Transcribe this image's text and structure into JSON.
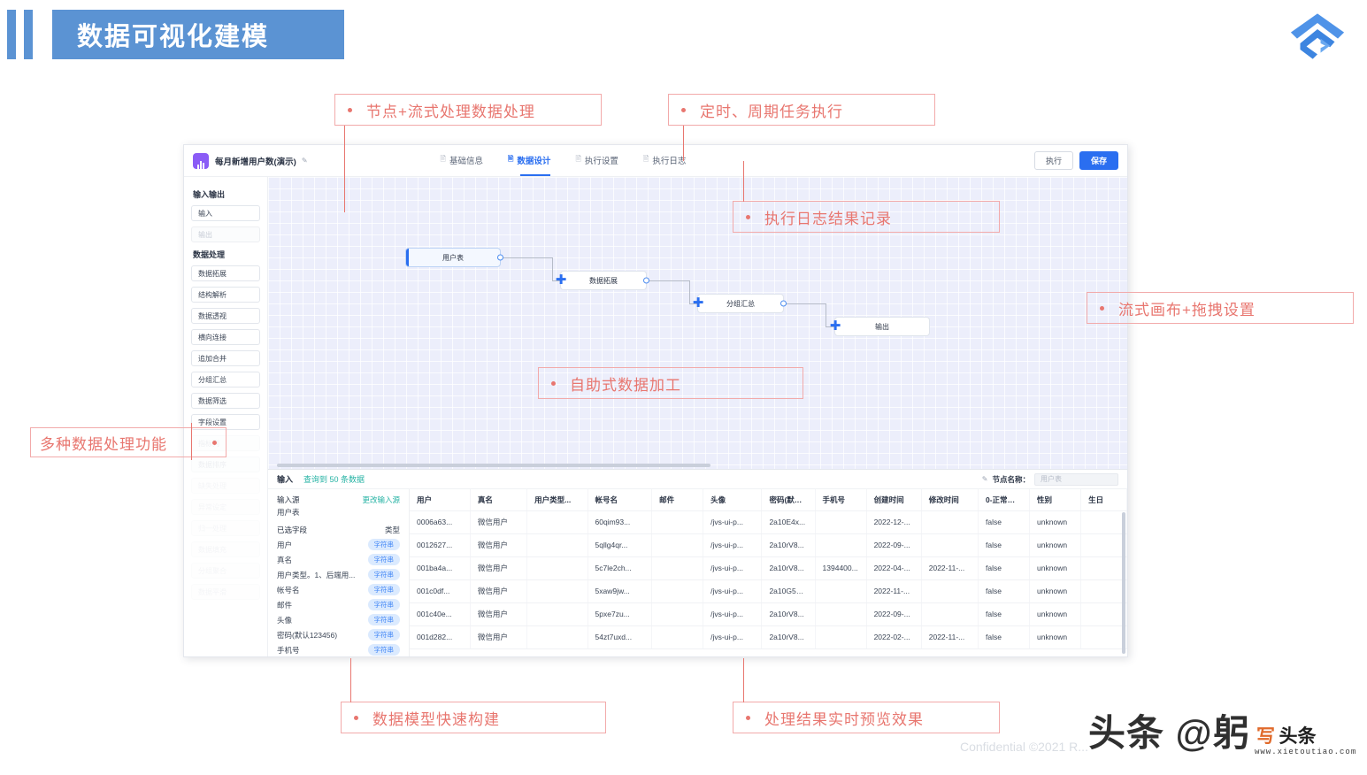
{
  "slide": {
    "title": "数据可视化建模",
    "footer": "Confidential ©2021 R...",
    "watermark": "头条 @躬",
    "watermark_badge_1": "写",
    "watermark_badge_2": "头条",
    "watermark_url": "www.xietoutiao.com",
    "logo": "company-logo-icon",
    "accent_color": "#5b93d3",
    "callout_color": "#e8766f"
  },
  "callouts": [
    {
      "id": "c1",
      "text": "节点+流式处理数据处理"
    },
    {
      "id": "c2",
      "text": "定时、周期任务执行"
    },
    {
      "id": "c3",
      "text": "执行日志结果记录"
    },
    {
      "id": "c4",
      "text": "流式画布+拖拽设置"
    },
    {
      "id": "c5",
      "text": "自助式数据加工"
    },
    {
      "id": "c6",
      "text": "多种数据处理功能"
    },
    {
      "id": "c7",
      "text": "数据模型快速构建"
    },
    {
      "id": "c8",
      "text": "处理结果实时预览效果"
    }
  ],
  "app": {
    "doc_title": "每月新增用户数(演示)",
    "edit_icon": "pencil-icon",
    "tabs": [
      {
        "label": "基础信息",
        "icon": "doc-icon",
        "active": false
      },
      {
        "label": "数据设计",
        "icon": "doc-icon",
        "active": true
      },
      {
        "label": "执行设置",
        "icon": "doc-icon",
        "active": false
      },
      {
        "label": "执行日志",
        "icon": "doc-icon",
        "active": false
      }
    ],
    "actions": {
      "run": "执行",
      "save": "保存"
    },
    "sidebar": {
      "group_io": "输入输出",
      "group_process": "数据处理",
      "io_items": [
        {
          "label": "输入",
          "state": "enabled"
        },
        {
          "label": "输出",
          "state": "disabled"
        }
      ],
      "process_items": [
        {
          "label": "数据拓展",
          "state": "enabled",
          "fade": "none"
        },
        {
          "label": "结构解析",
          "state": "enabled",
          "fade": "none"
        },
        {
          "label": "数据透视",
          "state": "enabled",
          "fade": "none"
        },
        {
          "label": "横向连接",
          "state": "enabled",
          "fade": "none"
        },
        {
          "label": "追加合并",
          "state": "enabled",
          "fade": "none"
        },
        {
          "label": "分组汇总",
          "state": "enabled",
          "fade": "none"
        },
        {
          "label": "数据筛选",
          "state": "enabled",
          "fade": "none"
        },
        {
          "label": "字段设置",
          "state": "enabled",
          "fade": "none"
        },
        {
          "label": "指标列",
          "state": "disabled",
          "fade": "faded"
        },
        {
          "label": "数据排序",
          "state": "disabled",
          "fade": "faded"
        },
        {
          "label": "缺失处理",
          "state": "disabled",
          "fade": "faded2"
        },
        {
          "label": "异常设定",
          "state": "disabled",
          "fade": "faded2"
        },
        {
          "label": "归一处理",
          "state": "disabled",
          "fade": "faded2"
        },
        {
          "label": "数据填充",
          "state": "disabled",
          "fade": "faded2"
        },
        {
          "label": "分组聚合",
          "state": "disabled",
          "fade": "faded2"
        },
        {
          "label": "数据平滑",
          "state": "disabled",
          "fade": "faded2"
        }
      ]
    },
    "canvas": {
      "nodes": [
        {
          "id": "n1",
          "label": "用户表",
          "kind": "source"
        },
        {
          "id": "n2",
          "label": "数据拓展",
          "kind": "process"
        },
        {
          "id": "n3",
          "label": "分组汇总",
          "kind": "process"
        },
        {
          "id": "n4",
          "label": "输出",
          "kind": "sink"
        }
      ]
    },
    "data_panel": {
      "input_label": "输入",
      "count_text": "查询到 50 条数据",
      "node_name_label": "节点名称：",
      "node_name_value": "用户表",
      "source_label": "输入源",
      "change_source": "更改输入源",
      "source_value": "用户表",
      "selected_fields_label": "已选字段",
      "type_label": "类型",
      "fields": [
        {
          "name": "用户",
          "type": "字符串"
        },
        {
          "name": "真名",
          "type": "字符串"
        },
        {
          "name": "用户类型。1、后端用...",
          "type": "字符串"
        },
        {
          "name": "帐号名",
          "type": "字符串"
        },
        {
          "name": "邮件",
          "type": "字符串"
        },
        {
          "name": "头像",
          "type": "字符串"
        },
        {
          "name": "密码(默认123456)",
          "type": "字符串"
        },
        {
          "name": "手机号",
          "type": "字符串"
        }
      ],
      "table": {
        "columns": [
          "用户",
          "真名",
          "用户类型...",
          "帐号名",
          "邮件",
          "头像",
          "密码(默认...",
          "手机号",
          "创建时间",
          "修改时间",
          "0-正常，1...",
          "性别",
          "生日"
        ],
        "rows": [
          [
            "0006a63...",
            "微信用户",
            "",
            "60qim93...",
            "",
            "/jvs-ui-p...",
            "2a10E4x...",
            "",
            "2022-12-...",
            "",
            "false",
            "unknown",
            ""
          ],
          [
            "0012627...",
            "微信用户",
            "",
            "5qllg4qr...",
            "",
            "/jvs-ui-p...",
            "2a10rV8...",
            "",
            "2022-09-...",
            "",
            "false",
            "unknown",
            ""
          ],
          [
            "001ba4a...",
            "微信用户",
            "",
            "5c7le2ch...",
            "",
            "/jvs-ui-p...",
            "2a10rV8...",
            "1394400...",
            "2022-04-...",
            "2022-11-...",
            "false",
            "unknown",
            ""
          ],
          [
            "001c0df...",
            "微信用户",
            "",
            "5xaw9jw...",
            "",
            "/jvs-ui-p...",
            "2a10G5U...",
            "",
            "2022-11-...",
            "",
            "false",
            "unknown",
            ""
          ],
          [
            "001c40e...",
            "微信用户",
            "",
            "5pxe7zu...",
            "",
            "/jvs-ui-p...",
            "2a10rV8...",
            "",
            "2022-09-...",
            "",
            "false",
            "unknown",
            ""
          ],
          [
            "001d282...",
            "微信用户",
            "",
            "54zt7uxd...",
            "",
            "/jvs-ui-p...",
            "2a10rV8...",
            "",
            "2022-02-...",
            "2022-11-...",
            "false",
            "unknown",
            ""
          ]
        ]
      }
    }
  }
}
